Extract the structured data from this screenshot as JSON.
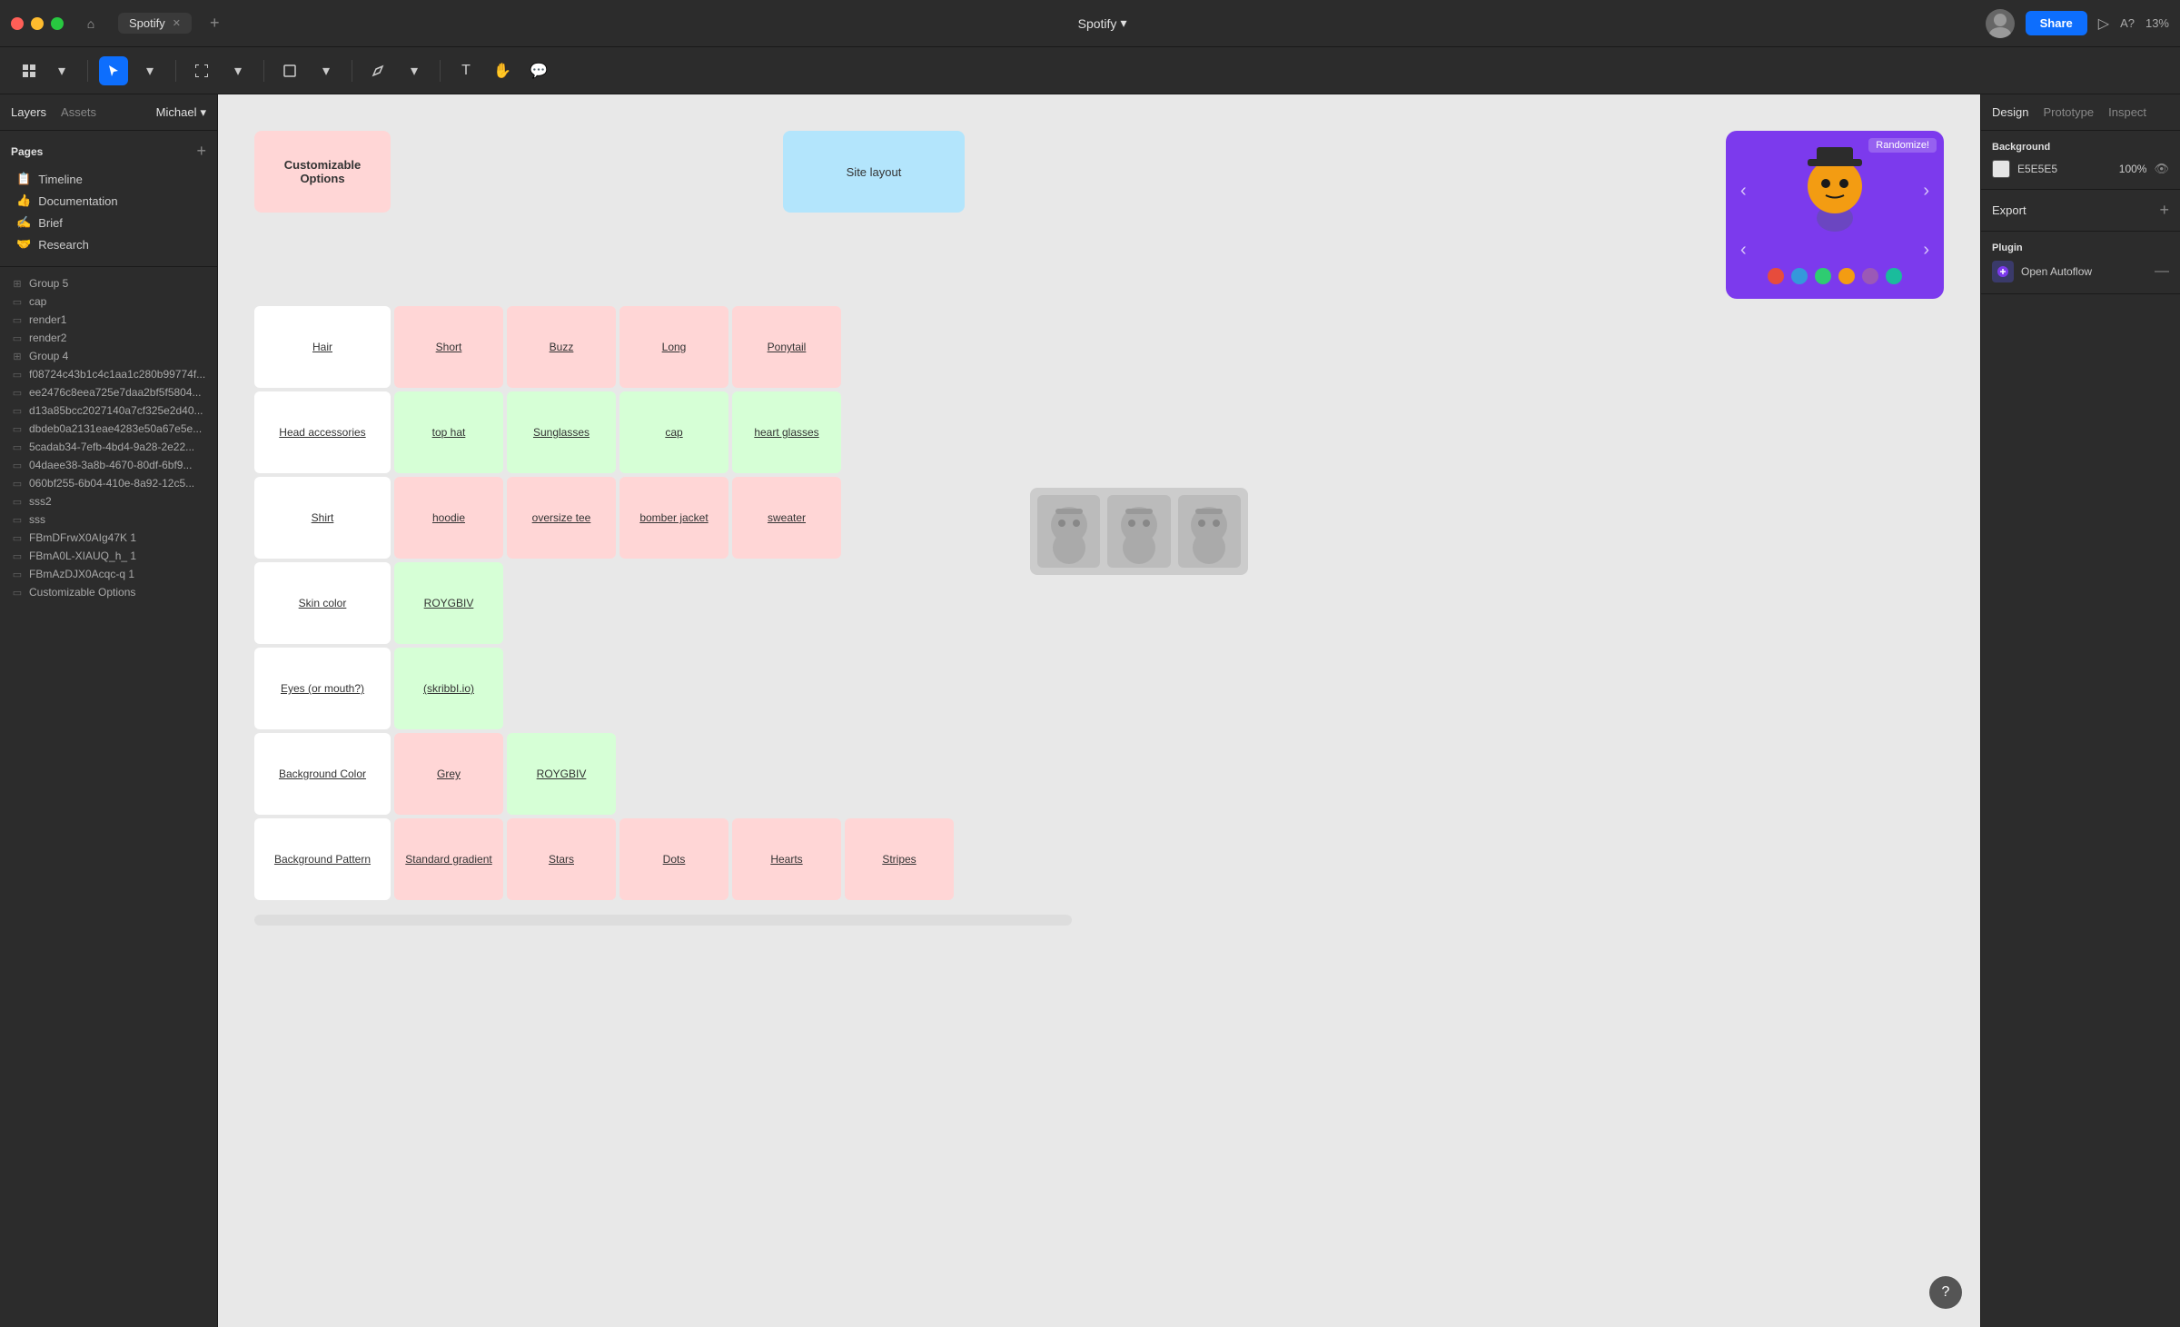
{
  "app": {
    "title": "Spotify",
    "project_name": "Spotify",
    "zoom": "13%"
  },
  "titlebar": {
    "tab_label": "Spotify",
    "share_label": "Share",
    "help_label": "A?",
    "zoom_label": "13%"
  },
  "left_panel": {
    "tabs": [
      "Layers",
      "Assets"
    ],
    "user": "Michael",
    "pages_label": "Pages",
    "pages": [
      {
        "emoji": "📋",
        "label": "Timeline"
      },
      {
        "emoji": "👍",
        "label": "Documentation"
      },
      {
        "emoji": "✍️",
        "label": "Brief"
      },
      {
        "emoji": "🤝",
        "label": "Research"
      }
    ],
    "layers": [
      {
        "icon": "group",
        "label": "Group 5"
      },
      {
        "icon": "rect",
        "label": "cap"
      },
      {
        "icon": "rect",
        "label": "render1"
      },
      {
        "icon": "rect",
        "label": "render2"
      },
      {
        "icon": "group",
        "label": "Group 4"
      },
      {
        "icon": "rect",
        "label": "f08724c43b1c4c1aa1c280b99774f..."
      },
      {
        "icon": "rect",
        "label": "ee2476c8eea725e7daa2bf5f5804..."
      },
      {
        "icon": "rect",
        "label": "d13a85bcc2027140a7cf325e2d40..."
      },
      {
        "icon": "rect",
        "label": "dbdeb0a2131eae4283e50a67e5e..."
      },
      {
        "icon": "rect",
        "label": "5cadab34-7efb-4bd4-9a28-2e22..."
      },
      {
        "icon": "rect",
        "label": "04daee38-3a8b-4670-80df-6bf9..."
      },
      {
        "icon": "rect",
        "label": "060bf255-6b04-410e-8a92-12c5..."
      },
      {
        "icon": "rect",
        "label": "sss2"
      },
      {
        "icon": "rect",
        "label": "sss"
      },
      {
        "icon": "rect",
        "label": "FBmDFrwX0AIg47K 1"
      },
      {
        "icon": "rect",
        "label": "FBmA0L-XIAUQ_h_ 1"
      },
      {
        "icon": "rect",
        "label": "FBmAzDJX0Acqc-q 1"
      },
      {
        "icon": "rect",
        "label": "Customizable Options"
      }
    ]
  },
  "canvas": {
    "top_cards": {
      "customizable": "Customizable Options",
      "site_layout": "Site layout"
    },
    "rows": [
      {
        "label": "Hair",
        "options": [
          {
            "label": "Short",
            "color": "pink"
          },
          {
            "label": "Buzz",
            "color": "pink"
          },
          {
            "label": "Long",
            "color": "pink"
          },
          {
            "label": "Ponytail",
            "color": "pink"
          }
        ]
      },
      {
        "label": "Head accessories",
        "options": [
          {
            "label": "top hat",
            "color": "green"
          },
          {
            "label": "Sunglasses",
            "color": "green"
          },
          {
            "label": "cap",
            "color": "green"
          },
          {
            "label": "heart glasses",
            "color": "green"
          }
        ]
      },
      {
        "label": "Shirt",
        "options": [
          {
            "label": "hoodie",
            "color": "pink"
          },
          {
            "label": "oversize tee",
            "color": "pink"
          },
          {
            "label": "bomber jacket",
            "color": "pink"
          },
          {
            "label": "sweater",
            "color": "pink"
          }
        ]
      },
      {
        "label": "Skin color",
        "options": [
          {
            "label": "ROYGBIV",
            "color": "green"
          }
        ]
      },
      {
        "label": "Eyes (or mouth?)",
        "options": [
          {
            "label": "(skribbI.io)",
            "color": "green"
          }
        ]
      },
      {
        "label": "Background Color",
        "options": [
          {
            "label": "Grey",
            "color": "pink"
          },
          {
            "label": "ROYGBIV",
            "color": "green"
          }
        ]
      },
      {
        "label": "Background Pattern",
        "options": [
          {
            "label": "Standard gradient",
            "color": "pink"
          },
          {
            "label": "Stars",
            "color": "pink"
          },
          {
            "label": "Dots",
            "color": "pink"
          },
          {
            "label": "Hearts",
            "color": "pink"
          },
          {
            "label": "Stripes",
            "color": "pink"
          }
        ]
      }
    ],
    "preview": {
      "randomize_label": "Randomize!",
      "color_dots": [
        "#e74c3c",
        "#3498db",
        "#2ecc71",
        "#f39c12",
        "#9b59b6",
        "#1abc9c"
      ]
    }
  },
  "right_panel": {
    "tabs": [
      "Design",
      "Prototype",
      "Inspect"
    ],
    "active_tab": "Design",
    "background_section": {
      "title": "Background",
      "color": "E5E5E5",
      "opacity": "100%"
    },
    "export_section": {
      "title": "Export"
    },
    "plugin_section": {
      "title": "Plugin",
      "plugin_name": "Open Autoflow"
    }
  }
}
